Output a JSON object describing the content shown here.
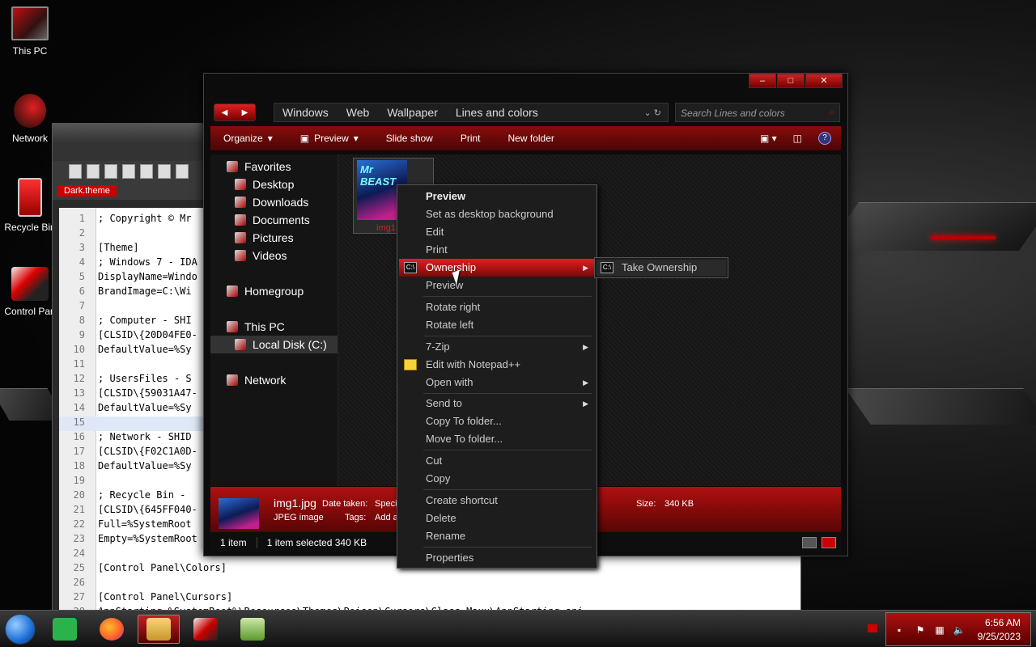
{
  "desktop": {
    "icons": [
      {
        "label": "This PC"
      },
      {
        "label": "Network"
      },
      {
        "label": "Recycle Bin"
      },
      {
        "label": "Control Pan"
      }
    ]
  },
  "notepad": {
    "tab_label": "Dark.theme",
    "lines": [
      {
        "n": "1",
        "t": "; Copyright © Mr"
      },
      {
        "n": "2",
        "t": ""
      },
      {
        "n": "3",
        "t": "[Theme]"
      },
      {
        "n": "4",
        "t": "; Windows 7 - IDA"
      },
      {
        "n": "5",
        "t": "DisplayName=Windo"
      },
      {
        "n": "6",
        "t": "BrandImage=C:\\Wi"
      },
      {
        "n": "7",
        "t": ""
      },
      {
        "n": "8",
        "t": "; Computer - SHI"
      },
      {
        "n": "9",
        "t": "[CLSID\\{20D04FE0-"
      },
      {
        "n": "10",
        "t": "DefaultValue=%Sy"
      },
      {
        "n": "11",
        "t": ""
      },
      {
        "n": "12",
        "t": "; UsersFiles - S"
      },
      {
        "n": "13",
        "t": "[CLSID\\{59031A47-"
      },
      {
        "n": "14",
        "t": "DefaultValue=%Sy"
      },
      {
        "n": "15",
        "t": ""
      },
      {
        "n": "16",
        "t": "; Network - SHID"
      },
      {
        "n": "17",
        "t": "[CLSID\\{F02C1A0D-"
      },
      {
        "n": "18",
        "t": "DefaultValue=%Sy"
      },
      {
        "n": "19",
        "t": ""
      },
      {
        "n": "20",
        "t": "; Recycle Bin -"
      },
      {
        "n": "21",
        "t": "[CLSID\\{645FF040-"
      },
      {
        "n": "22",
        "t": "Full=%SystemRoot"
      },
      {
        "n": "23",
        "t": "Empty=%SystemRoot"
      },
      {
        "n": "24",
        "t": ""
      },
      {
        "n": "25",
        "t": "[Control Panel\\Colors]"
      },
      {
        "n": "26",
        "t": ""
      },
      {
        "n": "27",
        "t": "[Control Panel\\Cursors]"
      },
      {
        "n": "28",
        "t": "AppStarting=%SystemRoot%\\Resources\\Themes\\Poison\\Cursors\\Glass Maxx\\AppStarting.ani"
      }
    ]
  },
  "explorer": {
    "caption": {
      "min": "‒",
      "max": "□",
      "close": "✕"
    },
    "breadcrumbs": [
      "Windows",
      "Web",
      "Wallpaper",
      "Lines and colors"
    ],
    "search_placeholder": "Search Lines and colors",
    "commands": {
      "organize": "Organize",
      "preview": "Preview",
      "slideshow": "Slide show",
      "print": "Print",
      "newfolder": "New folder"
    },
    "nav": {
      "favorites": "Favorites",
      "desktop": "Desktop",
      "downloads": "Downloads",
      "documents": "Documents",
      "pictures": "Pictures",
      "videos": "Videos",
      "homegroup": "Homegroup",
      "thispc": "This PC",
      "localdisk": "Local Disk (C:)",
      "network": "Network"
    },
    "file": {
      "thumb_text": "Mr BEAST",
      "label": "img1"
    },
    "details": {
      "name": "img1.jpg",
      "type": "JPEG image",
      "date_key": "Date taken:",
      "date_val": "Speci",
      "tags_key": "Tags:",
      "tags_val": "Add a",
      "size_key": "Size:",
      "size_val": "340 KB"
    },
    "status": {
      "count": "1 item",
      "selected": "1 item selected  340 KB"
    }
  },
  "context_menu": {
    "items": {
      "preview_bold": "Preview",
      "setbg": "Set as desktop background",
      "edit": "Edit",
      "print": "Print",
      "ownership": "Ownership",
      "preview2": "Preview",
      "rotright": "Rotate right",
      "rotleft": "Rotate left",
      "zip": "7-Zip",
      "notepadpp": "Edit with Notepad++",
      "openwith": "Open with",
      "sendto": "Send to",
      "copyto": "Copy To folder...",
      "moveto": "Move To folder...",
      "cut": "Cut",
      "copy": "Copy",
      "shortcut": "Create shortcut",
      "delete": "Delete",
      "rename": "Rename",
      "properties": "Properties"
    },
    "submenu": {
      "take_ownership": "Take Ownership"
    }
  },
  "taskbar": {
    "time": "6:56 AM",
    "date": "9/25/2023"
  },
  "colors": {
    "accent": "#c01010",
    "background": "#0a0a0a"
  }
}
